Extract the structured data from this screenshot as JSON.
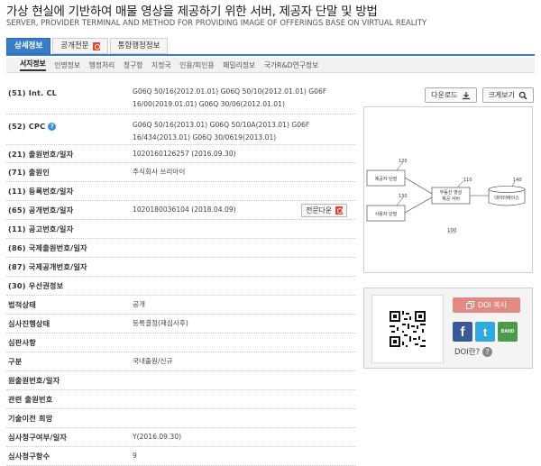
{
  "header": {
    "title": "가상 현실에 기반하여 매물 영상을 제공하기 위한 서버, 제공자 단말 및 방법",
    "subtitle": "SERVER, PROVIDER TERMINAL AND METHOD FOR PROVIDING IMAGE OF OFFERINGS BASE ON VIRTUAL REALITY"
  },
  "tabs": [
    {
      "label": "상세정보",
      "active": true
    },
    {
      "label": "공개전문",
      "icon": "pdf-icon"
    },
    {
      "label": "통합행정정보"
    }
  ],
  "subtabs": [
    "서지정보",
    "인명정보",
    "행정처리",
    "청구항",
    "지정국",
    "인용/피인용",
    "패밀리정보",
    "국가R&D연구정보"
  ],
  "buttons": {
    "download": "다운로드",
    "zoom": "크게보기",
    "fulltext_download": "전문다운",
    "doi_copy": "DOI 복사",
    "doi_question": "DOI란?"
  },
  "rows": [
    {
      "label": "(51) Int. CL",
      "value": [
        "G06Q 50/16(2012.01.01) G06Q 50/10(2012.01.01) G06F",
        "16/00(2019.01.01) G06Q 30/06(2012.01.01)"
      ]
    },
    {
      "label": "(52) CPC",
      "value": [
        "G06Q 50/16(2013.01) G06Q 50/10A(2013.01) G06F",
        "16/434(2013.01) G06Q 30/0619(2013.01)"
      ]
    },
    {
      "label": "(21) 출원번호/일자",
      "value": [
        "1020160126257 (2016.09.30)"
      ]
    },
    {
      "label": "(71) 출원인",
      "value": [
        "주식회사 쓰리아이"
      ]
    },
    {
      "label": "(11) 등록번호/일자",
      "value": [
        ""
      ]
    },
    {
      "label": "(65) 공개번호/일자",
      "value": [
        "1020180036104 (2018.04.09)"
      ]
    },
    {
      "label": "(11) 공고번호/일자",
      "value": [
        ""
      ]
    },
    {
      "label": "(86) 국제출원번호/일자",
      "value": [
        ""
      ]
    },
    {
      "label": "(87) 국제공개번호/일자",
      "value": [
        ""
      ]
    },
    {
      "label": "(30) 우선권정보",
      "value": [
        ""
      ]
    },
    {
      "label": "법적상태",
      "value": [
        "공개"
      ]
    },
    {
      "label": "심사진행상태",
      "value": [
        "등록결정(재심사후)"
      ]
    },
    {
      "label": "심판사항",
      "value": [
        ""
      ]
    },
    {
      "label": "구분",
      "value": [
        "국내출원/신규"
      ]
    },
    {
      "label": "원출원번호/일자",
      "value": [
        ""
      ]
    },
    {
      "label": "관련 출원번호",
      "value": [
        ""
      ]
    },
    {
      "label": "기술이전 희망",
      "value": [
        ""
      ]
    },
    {
      "label": "심사청구여부/일자",
      "value": [
        "Y(2016.09.30)"
      ]
    },
    {
      "label": "심사청구항수",
      "value": [
        "9"
      ]
    }
  ],
  "drawing": {
    "labels": {
      "n120": "120",
      "n130": "130",
      "n110": "110",
      "n140": "140",
      "n100": "100"
    },
    "boxes": {
      "provider": "제공자 단말",
      "user": "사용자 단말",
      "server_line1": "부동산 영상",
      "server_line2": "제공 서버",
      "db": "데이터베이스"
    }
  },
  "social": {
    "fb": "f",
    "tw": "t",
    "band": "BAND"
  }
}
